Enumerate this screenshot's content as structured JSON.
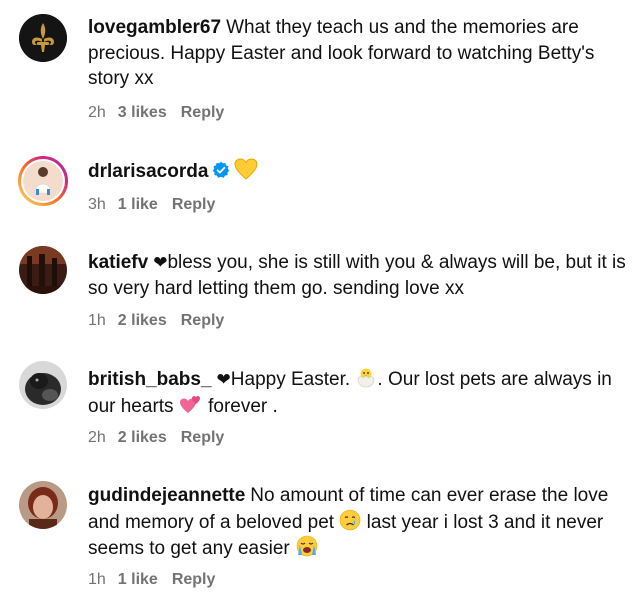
{
  "comments": [
    {
      "username": "lovegambler67",
      "text": "What they teach us and the memories are precious. Happy Easter and look forward to watching Betty's story xx",
      "time": "2h",
      "likes": "3 likes",
      "reply": "Reply"
    },
    {
      "username": "drlarisacorda",
      "verified": true,
      "text": "",
      "time": "3h",
      "likes": "1 like",
      "reply": "Reply"
    },
    {
      "username": "katiefv",
      "text": "bless you, she is still with you & always will be, but it is so very hard letting them go. sending love xx",
      "time": "1h",
      "likes": "2 likes",
      "reply": "Reply"
    },
    {
      "username": "british_babs_",
      "text_part1": "Happy Easter.",
      "text_part2": ". Our lost pets are always in our hearts",
      "text_part3": "forever .",
      "time": "2h",
      "likes": "2 likes",
      "reply": "Reply"
    },
    {
      "username": "gudindejeannette",
      "text_part1": "No amount of time can ever erase the love and memory of a beloved pet",
      "text_part2": "last year i lost 3 and it never seems to get any easier",
      "time": "1h",
      "likes": "1 like",
      "reply": "Reply"
    }
  ],
  "colors": {
    "meta_text": "#737373",
    "verified_blue": "#0095f6",
    "heart_black": "#111111",
    "story_ring": "#d62976"
  },
  "icons": [
    "fleur-de-lis-icon",
    "verified-badge-icon",
    "yellow-heart-icon",
    "black-heart-icon",
    "hatching-chick-icon",
    "two-hearts-icon",
    "crying-face-icon",
    "loudly-crying-face-icon"
  ]
}
